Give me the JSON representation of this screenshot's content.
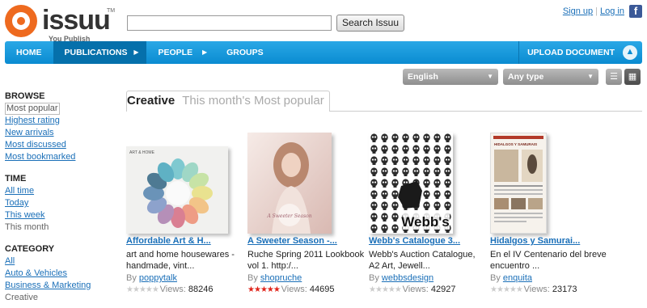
{
  "header": {
    "logo_text": "issuu",
    "logo_tm": "TM",
    "tagline": "You Publish",
    "search_placeholder": "",
    "search_button": "Search Issuu",
    "signup": "Sign up",
    "login": "Log in",
    "facebook": "f"
  },
  "nav": {
    "items": [
      "HOME",
      "PUBLICATIONS",
      "PEOPLE",
      "GROUPS"
    ],
    "upload": "UPLOAD DOCUMENT"
  },
  "filters": {
    "language": "English",
    "type": "Any type"
  },
  "sidebar": {
    "browse_heading": "BROWSE",
    "browse": [
      "Most popular",
      "Highest rating",
      "New arrivals",
      "Most discussed",
      "Most bookmarked"
    ],
    "time_heading": "TIME",
    "time": [
      "All time",
      "Today",
      "This week",
      "This month"
    ],
    "category_heading": "CATEGORY",
    "category": [
      "All",
      "Auto & Vehicles",
      "Business & Marketing",
      "Creative"
    ]
  },
  "tabs": {
    "active": "Creative",
    "inactive": "This month's Most popular"
  },
  "cards": [
    {
      "title": "Affordable Art & H...",
      "desc": "art and home housewares - handmade, vint...",
      "by_label": "By",
      "author": "poppytalk",
      "rating": 0,
      "views_label": "Views:",
      "views": "88246",
      "thumb_text": "ART & HOME"
    },
    {
      "title": "A Sweeter Season -...",
      "desc": "Ruche Spring 2011 Lookbook vol 1. http:/...",
      "by_label": "By",
      "author": "shopruche",
      "rating": 5,
      "views_label": "Views:",
      "views": "44695",
      "thumb_text": "A Sweeter Season"
    },
    {
      "title": "Webb's Catalogue 3...",
      "desc": "Webb's Auction Catalogue, A2 Art, Jewell...",
      "by_label": "By",
      "author": "webbsdesign",
      "rating": 0,
      "views_label": "Views:",
      "views": "42927",
      "thumb_text": "Webb's"
    },
    {
      "title": "Hidalgos y Samurai...",
      "desc": "En el IV Centenario del breve encuentro ...",
      "by_label": "By",
      "author": "enquita",
      "rating": 0,
      "views_label": "Views:",
      "views": "23173",
      "thumb_text": "HIDALGOS Y SAMURAIS"
    }
  ],
  "colors": {
    "nav_blue": "#0a8bd1",
    "link": "#1a6fb8",
    "brand_orange": "#ee6a1f",
    "star_red": "#e0251b"
  }
}
